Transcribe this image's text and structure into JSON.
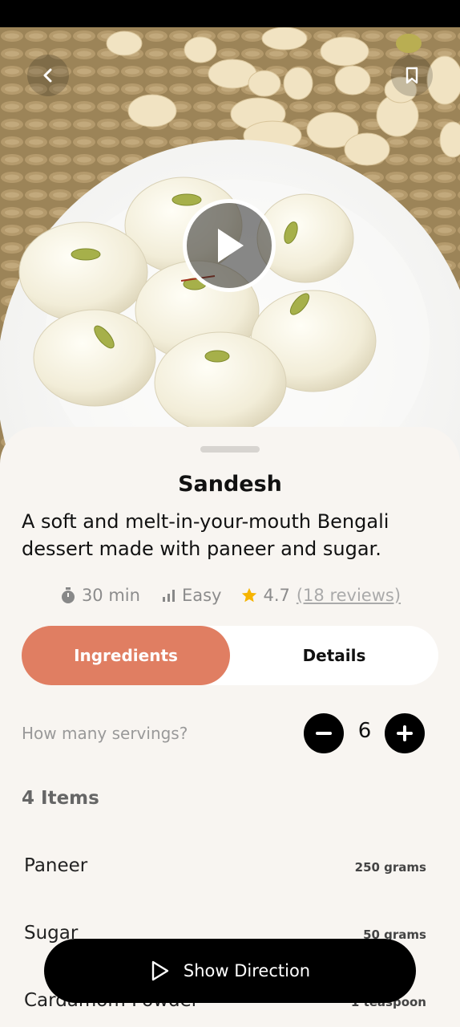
{
  "app": {
    "status_bar_color": "#000000",
    "accent_color": "#e07e62"
  },
  "hero": {
    "image_subject": "Plate of sandesh sweets garnished with pistachios",
    "back_icon": "chevron-left-icon",
    "bookmark_icon": "bookmark-icon",
    "play_icon": "play-icon"
  },
  "recipe": {
    "title": "Sandesh",
    "description": "A soft and melt-in-your-mouth Bengali dessert made with paneer and sugar.",
    "time": "30 min",
    "difficulty": "Easy",
    "rating": "4.7",
    "reviews": "(18 reviews)"
  },
  "tabs": {
    "ingredients": "Ingredients",
    "details": "Details",
    "active": "Ingredients"
  },
  "servings": {
    "label": "How many servings?",
    "value": "6"
  },
  "ingredients": {
    "count_label": "4 Items",
    "items": [
      {
        "name": "Paneer",
        "qty": "250 grams"
      },
      {
        "name": "Sugar",
        "qty": "50 grams"
      },
      {
        "name": "Cardamom Powder",
        "qty": "1 teaspoon"
      }
    ]
  },
  "action": {
    "label": "Show Direction"
  }
}
